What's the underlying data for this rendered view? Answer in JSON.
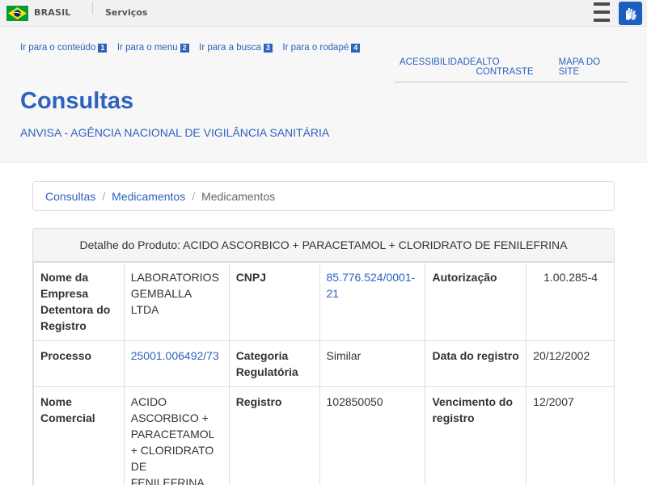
{
  "gov_bar": {
    "country": "BRASIL",
    "services": "Serviços",
    "flag_icon": "brazil-flag-icon",
    "menu_icon": "hamburger-menu-icon",
    "accessibility_icon": "vlibras-hands-icon",
    "accent_color": "#1b5fbf"
  },
  "skip_links": [
    {
      "label": "Ir para o conteúdo",
      "num": "1"
    },
    {
      "label": "Ir para o menu",
      "num": "2"
    },
    {
      "label": "Ir para a busca",
      "num": "3"
    },
    {
      "label": "Ir para o rodapé",
      "num": "4"
    }
  ],
  "access_links": [
    "ACESSIBILIDADE",
    "ALTO CONTRASTE",
    "MAPA DO SITE"
  ],
  "header": {
    "title": "Consultas",
    "subtitle": "ANVISA - AGÊNCIA NACIONAL DE VIGILÂNCIA SANITÁRIA",
    "link_color": "#2d62bd"
  },
  "breadcrumb": {
    "items": [
      "Consultas",
      "Medicamentos"
    ],
    "current": "Medicamentos"
  },
  "product": {
    "heading": "Detalhe do Produto: ACIDO ASCORBICO + PARACETAMOL + CLORIDRATO DE FENILEFRINA",
    "rows": [
      [
        {
          "label": "Nome da Empresa Detentora do Registro",
          "value": "LABORATORIOS GEMBALLA LTDA"
        },
        {
          "label": "CNPJ",
          "value": "85.776.524/0001-21"
        },
        {
          "label": "Autorização",
          "value": "1.00.285-4"
        }
      ],
      [
        {
          "label": "Processo",
          "value": "25001.006492/73"
        },
        {
          "label": "Categoria Regulatória",
          "value": "Similar"
        },
        {
          "label": "Data do registro",
          "value": "20/12/2002"
        }
      ],
      [
        {
          "label": "Nome Comercial",
          "value": "ACIDO ASCORBICO + PARACETAMOL + CLORIDRATO DE FENILEFRINA"
        },
        {
          "label": "Registro",
          "value": "102850050"
        },
        {
          "label": "Vencimento do registro",
          "value": "12/2007"
        }
      ]
    ]
  }
}
